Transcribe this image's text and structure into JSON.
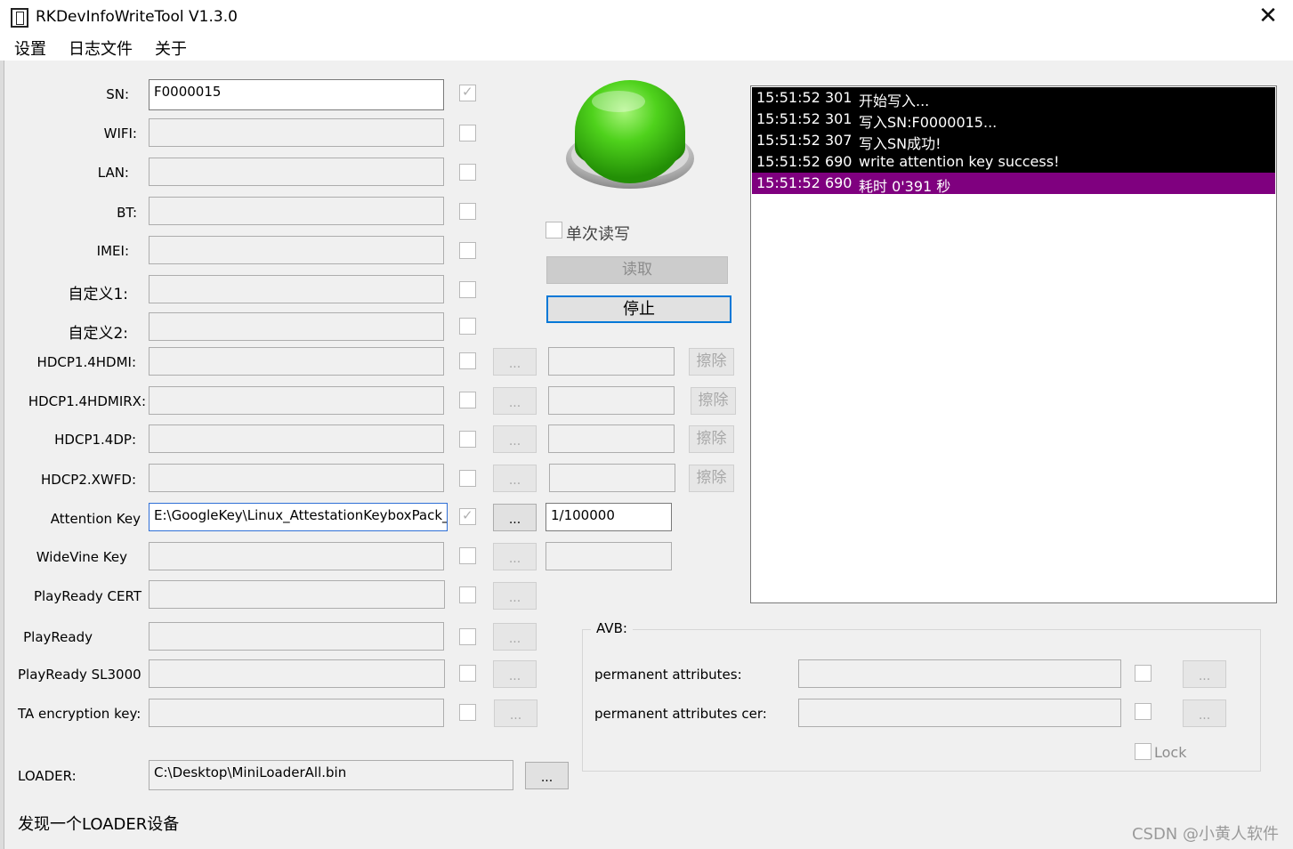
{
  "window": {
    "title": "RKDevInfoWriteTool V1.3.0",
    "close": "✕"
  },
  "menu": [
    "设置",
    "日志文件",
    "关于"
  ],
  "fields": [
    {
      "label": "SN:",
      "value": "F0000015",
      "checked": true
    },
    {
      "label": "WIFI:",
      "value": "",
      "checked": false
    },
    {
      "label": "LAN:",
      "value": "",
      "checked": false
    },
    {
      "label": "BT:",
      "value": "",
      "checked": false
    },
    {
      "label": "IMEI:",
      "value": "",
      "checked": false
    },
    {
      "label": "自定义1:",
      "value": "",
      "checked": false
    },
    {
      "label": "自定义2:",
      "value": "",
      "checked": false
    },
    {
      "label": "HDCP1.4HDMI:",
      "value": "",
      "checked": false,
      "browse": "...",
      "file": "",
      "erase": "擦除"
    },
    {
      "label": "HDCP1.4HDMIRX:",
      "value": "",
      "checked": false,
      "browse": "...",
      "file": "",
      "erase": "擦除"
    },
    {
      "label": "HDCP1.4DP:",
      "value": "",
      "checked": false,
      "browse": "...",
      "file": "",
      "erase": "擦除"
    },
    {
      "label": "HDCP2.XWFD:",
      "value": "",
      "checked": false,
      "browse": "...",
      "file": "",
      "erase": "擦除"
    },
    {
      "label": "Attention Key",
      "value": "E:\\GoogleKey\\Linux_AttestationKeyboxPack_",
      "checked": true,
      "browse": "...",
      "count": "1/100000"
    },
    {
      "label": "WideVine Key",
      "value": "",
      "checked": false,
      "browse": "...",
      "count": ""
    },
    {
      "label": "PlayReady CERT",
      "value": "",
      "checked": false,
      "browse": "..."
    },
    {
      "label": "PlayReady",
      "value": "",
      "checked": false,
      "browse": "..."
    },
    {
      "label": "PlayReady SL3000",
      "value": "",
      "checked": false,
      "browse": "..."
    },
    {
      "label": "TA encryption key:",
      "value": "",
      "checked": false,
      "browse": "..."
    }
  ],
  "controls": {
    "single_rw": "单次读写",
    "read_button": "读取",
    "stop_button": "停止"
  },
  "log": [
    {
      "time": "15:51:52 301",
      "msg": "开始写入..."
    },
    {
      "time": "15:51:52 301",
      "msg": "写入SN:F0000015..."
    },
    {
      "time": "15:51:52 307",
      "msg": "写入SN成功!"
    },
    {
      "time": "15:51:52 690",
      "msg": "write attention key success!"
    },
    {
      "time": "15:51:52 690",
      "msg": "耗时 0'391 秒",
      "selected": true
    }
  ],
  "avb": {
    "title": "AVB:",
    "perm_attr_label": "permanent attributes:",
    "perm_attr_value": "",
    "perm_attr_cer_label": "permanent attributes cer:",
    "perm_attr_cer_value": "",
    "browse": "...",
    "lock": "Lock"
  },
  "loader": {
    "label": "LOADER:",
    "value": "C:\\Desktop\\MiniLoaderAll.bin",
    "browse": "..."
  },
  "status": "发现一个LOADER设备",
  "watermark": "CSDN @小黄人软件"
}
